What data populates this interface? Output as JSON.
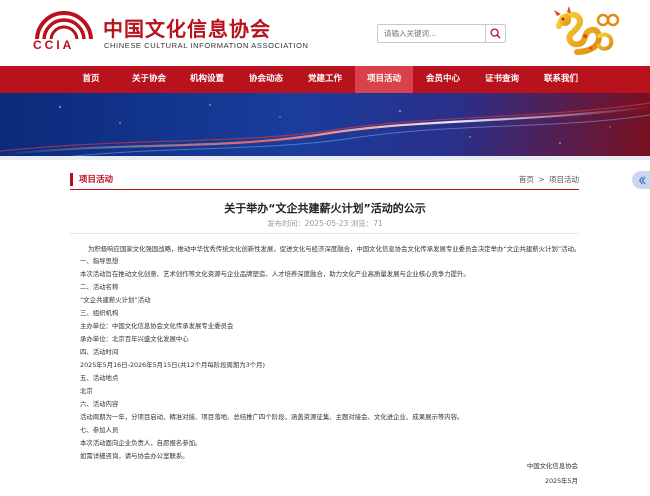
{
  "header": {
    "logo_text": "CCIA",
    "org_name_cn": "中国文化信息协会",
    "org_name_en": "CHINESE CULTURAL INFORMATION ASSOCIATION",
    "search_placeholder": "请输入关键词..."
  },
  "nav": {
    "items": [
      {
        "label": "首页"
      },
      {
        "label": "关于协会"
      },
      {
        "label": "机构设置"
      },
      {
        "label": "协会动态"
      },
      {
        "label": "党建工作"
      },
      {
        "label": "项目活动"
      },
      {
        "label": "会员中心"
      },
      {
        "label": "证书查询"
      },
      {
        "label": "联系我们"
      }
    ],
    "active_index": 5
  },
  "section": {
    "title": "项目活动",
    "breadcrumb": [
      "首页",
      ">",
      "项目活动"
    ]
  },
  "article": {
    "title": "关于举办“文企共建薪火计划”活动的公示",
    "meta": "发布时间：2025-05-23 浏览：71",
    "lines": [
      "为积极响应国家文化强国战略，推动中华优秀传统文化创新性发展，促进文化与经济深度融合，中国文化信息协会文化传承发展专业委员会决定举办“文企共建薪火计划”活动。",
      "一、指导思想",
      "本次活动旨在推动文化创意、艺术创作等文化资源与企业品牌塑造、人才培养深度融合，助力文化产业高质量发展与企业核心竞争力提升。",
      "二、活动名称",
      "“文企共建薪火计划”活动",
      "三、组织机构",
      "主办单位：中国文化信息协会文化传承发展专业委员会",
      "承办单位：北京百年兴盛文化发展中心",
      "四、活动时间",
      "2025年5月16日-2026年5月15日(共12个月每阶段周期为3个月)",
      "五、活动地点",
      "北京",
      "六、活动内容",
      "活动周期为一年，分项目启动、精准对接、项目落地、总结推广四个阶段，涵盖资源征集、主题对接会、文化进企业、成果展示等内容。",
      "七、参加人员",
      "本次活动面向企业负责人，自愿报名参加。",
      "如需详细咨询，请与协会办公室联系。"
    ],
    "signature_org": "中国文化信息协会",
    "signature_date": "2025年5月"
  },
  "colors": {
    "brand_red": "#b8121c",
    "nav_active": "#d9424a"
  }
}
